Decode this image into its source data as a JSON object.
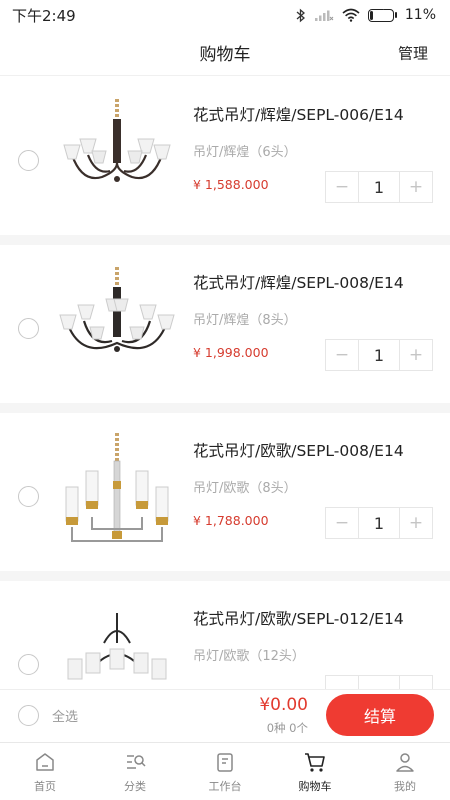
{
  "status_bar": {
    "time": "下午2:49",
    "battery": "11%"
  },
  "header": {
    "title": "购物车",
    "manage": "管理"
  },
  "cart": {
    "items": [
      {
        "title": "花式吊灯/辉煌/SEPL-006/E14",
        "spec": "吊灯/辉煌（6头）",
        "price": "¥ 1,588.000",
        "qty": "1",
        "dec": "−",
        "inc": "+"
      },
      {
        "title": "花式吊灯/辉煌/SEPL-008/E14",
        "spec": "吊灯/辉煌（8头）",
        "price": "¥ 1,998.000",
        "qty": "1",
        "dec": "−",
        "inc": "+"
      },
      {
        "title": "花式吊灯/欧歌/SEPL-008/E14",
        "spec": "吊灯/欧歌（8头）",
        "price": "¥ 1,788.000",
        "qty": "1",
        "dec": "−",
        "inc": "+"
      },
      {
        "title": "花式吊灯/欧歌/SEPL-012/E14",
        "spec": "吊灯/欧歌（12头）",
        "price": "",
        "qty": "",
        "dec": "",
        "inc": ""
      }
    ]
  },
  "checkout": {
    "select_all": "全选",
    "total": "¥0.00",
    "count": "0种 0个",
    "button": "结算"
  },
  "tabs": [
    {
      "label": "首页",
      "icon": "home-icon"
    },
    {
      "label": "分类",
      "icon": "category-icon"
    },
    {
      "label": "工作台",
      "icon": "workbench-icon"
    },
    {
      "label": "购物车",
      "icon": "cart-icon",
      "active": true
    },
    {
      "label": "我的",
      "icon": "profile-icon"
    }
  ],
  "colors": {
    "accent": "#ef3b32",
    "price": "#d63c2f"
  }
}
